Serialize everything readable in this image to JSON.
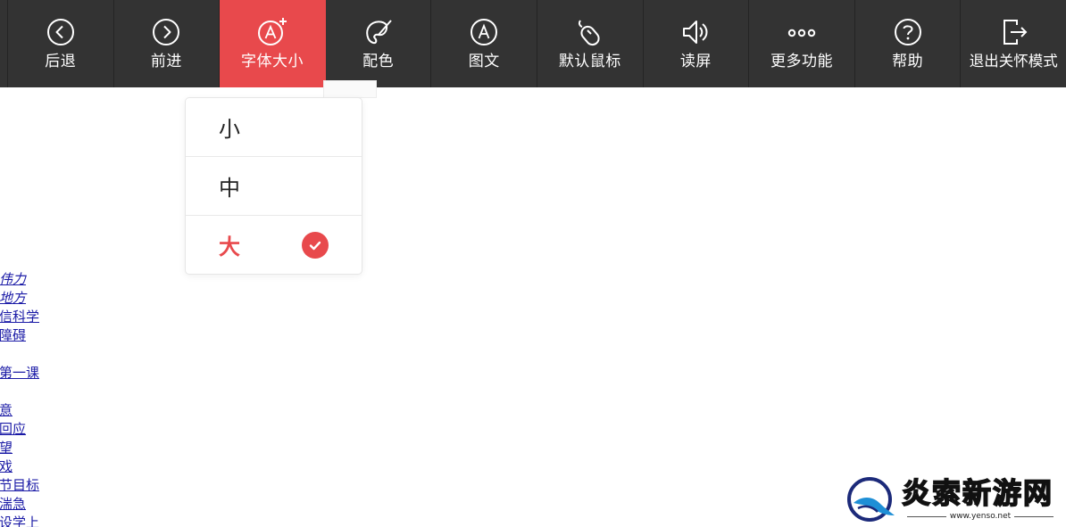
{
  "toolbar": {
    "items": [
      {
        "label": "后退",
        "icon": "back-icon"
      },
      {
        "label": "前进",
        "icon": "forward-icon"
      },
      {
        "label": "字体大小",
        "icon": "font-size-icon",
        "active": true
      },
      {
        "label": "配色",
        "icon": "palette-icon"
      },
      {
        "label": "图文",
        "icon": "text-image-icon"
      },
      {
        "label": "默认鼠标",
        "icon": "mouse-icon"
      },
      {
        "label": "读屏",
        "icon": "speaker-icon"
      },
      {
        "label": "更多功能",
        "icon": "more-icon"
      },
      {
        "label": "帮助",
        "icon": "help-icon"
      },
      {
        "label": "退出关怀模式",
        "icon": "exit-icon"
      }
    ]
  },
  "font_size_menu": {
    "options": [
      {
        "label": "小",
        "selected": false
      },
      {
        "label": "中",
        "selected": false
      },
      {
        "label": "大",
        "selected": true
      }
    ]
  },
  "page_links": [
    {
      "text": "伟力",
      "italic": true
    },
    {
      "text": "地方",
      "italic": true
    },
    {
      "text": "信科学",
      "italic": false
    },
    {
      "text": "障碍",
      "italic": false
    },
    {
      "text": "第一课",
      "italic": false
    },
    {
      "text": "意",
      "italic": false
    },
    {
      "text": "回应",
      "italic": false
    },
    {
      "text": "望",
      "italic": false
    },
    {
      "text": "戏",
      "italic": false
    },
    {
      "text": "节目标",
      "italic": false
    },
    {
      "text": "湍急",
      "italic": false
    },
    {
      "text": "设学上",
      "italic": false
    }
  ],
  "watermark": {
    "brand": "炎索新游网",
    "url": "www.yenso.net"
  },
  "colors": {
    "toolbar_bg": "#333333",
    "accent": "#e8494c",
    "link": "#1a1aa6"
  }
}
